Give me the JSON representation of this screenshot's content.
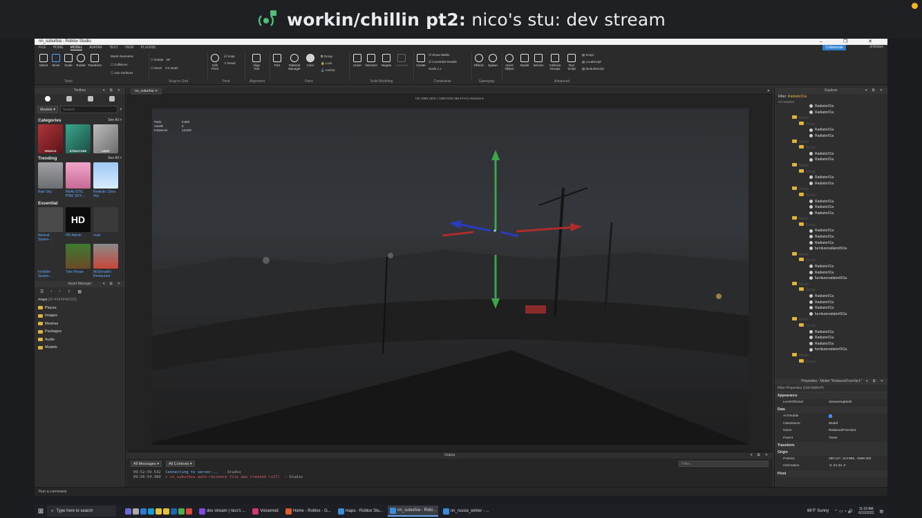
{
  "stream": {
    "title_bold": "workin/chillin pt2:",
    "title_rest": " nico's stu: dev stream"
  },
  "window": {
    "title": "nn_suburbia - Roblox Studio",
    "controls": "–  ❐  ✕"
  },
  "menu": {
    "file": "FILE",
    "tabs": [
      "HOME",
      "MODEL",
      "AVATAR",
      "TEST",
      "VIEW",
      "PLUGINS"
    ],
    "active_tab": "MODEL",
    "collaborate": "Collaborate",
    "user": "jmilsidae"
  },
  "ribbon": {
    "tools": {
      "select": "Select",
      "move": "Move",
      "scale": "Scale",
      "rotate": "Rotate",
      "transform": "Transform",
      "label": "Tools"
    },
    "mode": {
      "mode_label": "Mode",
      "mode_value": "Geometric",
      "collisions": "Collisions",
      "join": "Join Surfaces"
    },
    "snap": {
      "rotate": "Rotate",
      "rotate_val": "45°",
      "move": "Move",
      "move_val": "0.5 studs",
      "label": "Snap to Grid"
    },
    "pivot": {
      "edit": "Edit Pivot",
      "snap": "Snap",
      "reset": "Reset",
      "label": "Pivot"
    },
    "alignment": {
      "align": "Align Tool",
      "label": "Alignment"
    },
    "parts": {
      "part": "Part",
      "material": "Material Manager",
      "color": "Color",
      "group": "Group",
      "lock": "Lock",
      "anchor": "Anchor",
      "label": "Parts"
    },
    "solid": {
      "union": "Union",
      "intersect": "Intersect",
      "negate": "Negate",
      "separate": "Separate",
      "label": "Solid Modeling"
    },
    "constraints": {
      "create": "Create",
      "show_welds": "Show Welds",
      "constraint_details": "Constraint Details",
      "scale": "Scale",
      "scale_val": "1 x",
      "label": "Constraints"
    },
    "gameplay": {
      "effects": "Effects",
      "spawn": "Spawn",
      "label": "Gameplay"
    },
    "advanced": {
      "insert_object": "Insert Object",
      "model": "Model",
      "service": "Service",
      "collision_groups": "Collision Groups",
      "run_script": "Run Script",
      "script": "Script",
      "local_script": "LocalScript",
      "module_script": "ModuleScript",
      "label": "Advanced"
    }
  },
  "toolbox": {
    "header": "Toolbox",
    "dropdown": "Models",
    "search_placeholder": "Search",
    "categories_title": "Categories",
    "see_all": "See All >",
    "categories": [
      {
        "caption": "VEHICLE",
        "color": "#8a2a2e"
      },
      {
        "caption": "STRUCTURE",
        "color": "#2e7f6c"
      },
      {
        "caption": "LIGHT",
        "color": "#9a9a9a"
      }
    ],
    "trending_title": "Trending",
    "trending": [
      "Rain Sky",
      "REALISTIC PINK SKY-...",
      "Realistic Clear Sky"
    ],
    "essential_title": "Essential",
    "essential": [
      "Neutral Spawn-...",
      "HD Admin",
      "road",
      "Invisible Spawn-...",
      "Tree House",
      "McDonald's Restaurant"
    ]
  },
  "asset_manager": {
    "header": "Asset Manager",
    "maps": "maps",
    "maps_id": "[ID:4344848183]",
    "folders": [
      "Places",
      "Images",
      "Meshes",
      "Packages",
      "Audio",
      "Models"
    ]
  },
  "viewport": {
    "doc_tab": "nn_suburbia",
    "bar": "HD 1080   1920 x 1080   8192 MB   ▾          Fit to Window   ▾",
    "stats": [
      [
        "Parts",
        "9,092"
      ],
      [
        "Voxels",
        "0"
      ],
      [
        "Instances",
        "13,629"
      ]
    ]
  },
  "output": {
    "header": "Output",
    "filter1": "All Messages",
    "filter2": "All Contexts",
    "filter_box": "Filter...",
    "lines": [
      {
        "time": "09:52:59.532",
        "msg": "Connecting to server...",
        "src": "- Studio",
        "cls": "m1"
      },
      {
        "time": "09:56:54.989",
        "msg": "▸ nn_suburbia auto-recovery file was created (x17)",
        "src": "- Studio",
        "cls": "m2"
      }
    ]
  },
  "explorer": {
    "header": "Explorer",
    "filter_label": "Filter:",
    "filter_value": "Radiator01a",
    "matches": "34 matches",
    "rows": [
      "Radiator01a",
      "Radiator01a",
      "Model",
      "Group",
      "Radiator01a",
      "Radiator01a",
      "Model",
      "Group",
      "Radiator01a",
      "Radiator01a",
      "Model",
      "Group",
      "Radiator01a",
      "Radiator01a",
      "Model",
      "Group",
      "Radiator01a",
      "Radiator01a",
      "Radiator01a",
      "Model",
      "Group",
      "Radiator01a",
      "Radiator01a",
      "Radiator01a",
      "furnitureradiator001a",
      "Model",
      "Group",
      "Radiator01a",
      "Radiator01a",
      "furnitureradiator001a",
      "Model",
      "Group",
      "Radiator01a",
      "Radiator01a",
      "Radiator01a",
      "furnitureradiator001a",
      "Model",
      "Group",
      "Radiator01a",
      "Radiator01a",
      "Radiator01a",
      "furnitureradiator001a",
      "Model",
      "Group"
    ]
  },
  "properties": {
    "header": "Properties - Model \"RedwoodTreeVar1\"",
    "filter": "Filter Properties (Ctrl+Shift+P)",
    "cats": [
      {
        "name": "Appearance",
        "rows": [
          [
            "LevelOfDetail",
            "StreamingMesh"
          ]
        ]
      },
      {
        "name": "Data",
        "rows": [
          [
            "Archivable",
            "__check"
          ],
          [
            "ClassName",
            "Model"
          ],
          [
            "Name",
            "RedwoodTreeVar1"
          ],
          [
            "Parent",
            "Trees"
          ]
        ]
      },
      {
        "name": "Transform",
        "rows": []
      },
      {
        "name": "Origin",
        "rows": [
          [
            "Position",
            "450.147, 113.985, -1695.403"
          ],
          [
            "Orientation",
            "-0, 61.33, 0"
          ]
        ]
      },
      {
        "name": "Pivot",
        "rows": []
      }
    ]
  },
  "command": {
    "placeholder": "Run a command"
  },
  "taskbar": {
    "search": "Type here to search",
    "apps": [
      {
        "label": "dev stream | nico's ...",
        "color": "#7a4de0",
        "active": false
      },
      {
        "label": "Voicemod",
        "color": "#d03a6a",
        "active": false
      },
      {
        "label": "Home - Roblox - G...",
        "color": "#d95c2a",
        "active": false
      },
      {
        "label": "maps - Roblox Stu...",
        "color": "#3a8bd8",
        "active": false
      },
      {
        "label": "nn_suburbia - Robl...",
        "color": "#3a8bd8",
        "active": true
      },
      {
        "label": "nn_russia_winter - ...",
        "color": "#3a8bd8",
        "active": false
      }
    ],
    "weather": "66°F  Sunny",
    "time": "11:19 AM",
    "date": "6/10/2023"
  }
}
